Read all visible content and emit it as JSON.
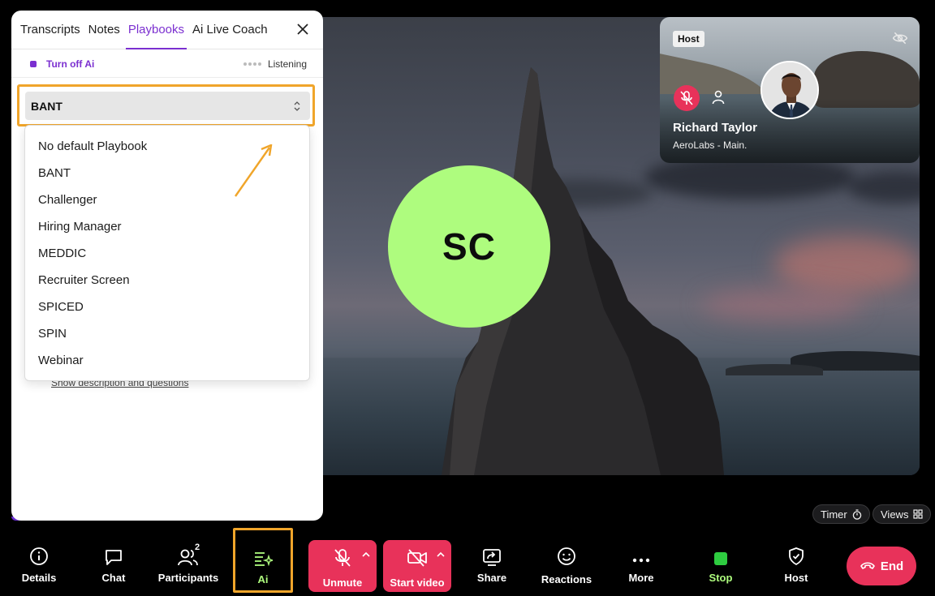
{
  "panel": {
    "tabs": [
      "Transcripts",
      "Notes",
      "Playbooks",
      "Ai Live Coach"
    ],
    "active_tab": "Playbooks",
    "ai_toggle_label": "Turn off Ai",
    "status_label": "Listening",
    "playbook_select": {
      "selected": "BANT"
    },
    "playbook_options": [
      "No default Playbook",
      "BANT",
      "Challenger",
      "Hiring Manager",
      "MEDDIC",
      "Recruiter Screen",
      "SPICED",
      "SPIN",
      "Webinar"
    ],
    "show_description_link": "Show description and questions"
  },
  "stage": {
    "avatar_initials": "SC",
    "avatar_color": "#aefc7e"
  },
  "host_tile": {
    "badge": "Host",
    "name": "Richard Taylor",
    "subtitle": "AeroLabs - Main."
  },
  "pills": {
    "timer": "Timer",
    "views": "Views"
  },
  "toolbar": {
    "details": "Details",
    "chat": "Chat",
    "participants": "Participants",
    "participants_count": "2",
    "ai": "Ai",
    "unmute": "Unmute",
    "start_video": "Start video",
    "share": "Share",
    "reactions": "Reactions",
    "more": "More",
    "stop": "Stop",
    "host": "Host",
    "end": "End"
  },
  "colors": {
    "accent_purple": "#7b2fd0",
    "danger_red": "#e8325a",
    "highlight_orange": "#f0a52a",
    "ai_green": "#aefc7e"
  }
}
